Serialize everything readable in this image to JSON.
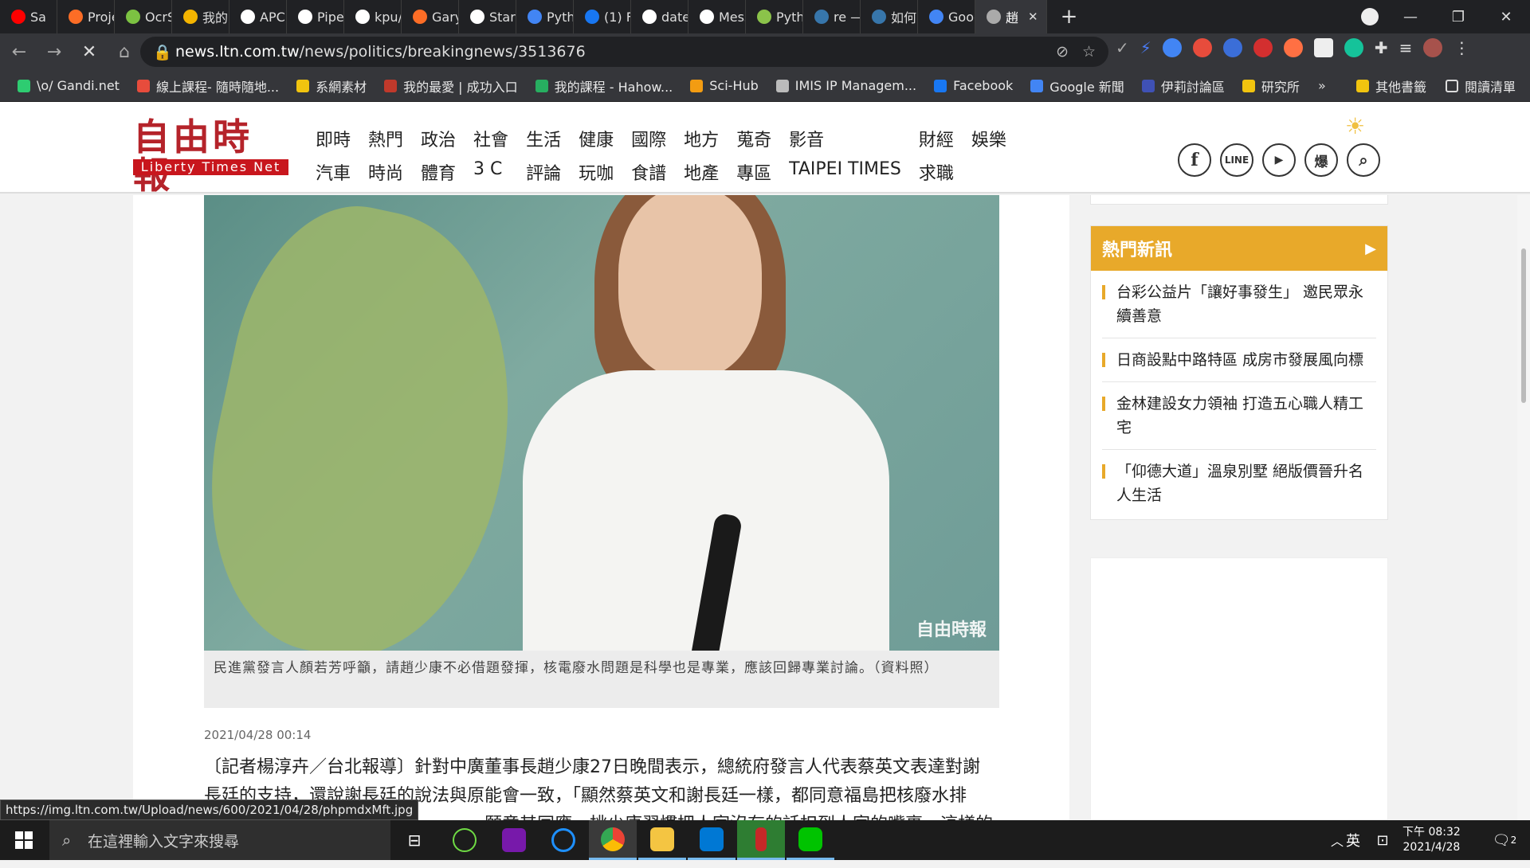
{
  "browser": {
    "tabs": [
      {
        "label": "Sa",
        "icon": "youtube-icon",
        "color": "#ff0000"
      },
      {
        "label": "Proje",
        "icon": "gitlab-icon",
        "color": "#fc6d26"
      },
      {
        "label": "OcrSI",
        "icon": "app-icon",
        "color": "#7cc242"
      },
      {
        "label": "我的",
        "icon": "drive-icon",
        "color": "#f4b400"
      },
      {
        "label": "APCL",
        "icon": "github-icon",
        "color": "#ffffff"
      },
      {
        "label": "Piper",
        "icon": "piper-icon",
        "color": "#ffffff"
      },
      {
        "label": "kpu/",
        "icon": "github-icon",
        "color": "#ffffff"
      },
      {
        "label": "Gary",
        "icon": "gitlab-icon",
        "color": "#fc6d26"
      },
      {
        "label": "Start",
        "icon": "start-icon",
        "color": "#ffffff"
      },
      {
        "label": "Pytho",
        "icon": "doc-icon",
        "color": "#4285f4"
      },
      {
        "label": "(1) Fa",
        "icon": "facebook-icon",
        "color": "#1877f2"
      },
      {
        "label": "datet",
        "icon": "google-icon",
        "color": "#ffffff"
      },
      {
        "label": "Mess",
        "icon": "google-icon",
        "color": "#ffffff"
      },
      {
        "label": "Pytho",
        "icon": "app-icon",
        "color": "#8bc34a"
      },
      {
        "label": "re —",
        "icon": "python-icon",
        "color": "#3776ab"
      },
      {
        "label": "如何",
        "icon": "python-icon",
        "color": "#3776ab"
      },
      {
        "label": "Goog",
        "icon": "translate-icon",
        "color": "#4285f4"
      },
      {
        "label": "趙",
        "icon": "loading-icon",
        "color": "#aaaaaa"
      }
    ],
    "new_tab": "+",
    "url_host": "news.ltn.com.tw",
    "url_path": "/news/politics/breakingnews/3513676",
    "bookmarks": [
      {
        "label": "\\o/ Gandi.net",
        "color": "#2ecc71"
      },
      {
        "label": "線上課程- 隨時隨地...",
        "color": "#e74c3c"
      },
      {
        "label": "系網素材",
        "color": "#f1c40f"
      },
      {
        "label": "我的最愛 | 成功入口",
        "color": "#c0392b"
      },
      {
        "label": "我的課程 - Hahow...",
        "color": "#27ae60"
      },
      {
        "label": "Sci-Hub",
        "color": "#f39c12"
      },
      {
        "label": "IMIS IP Managem...",
        "color": "#bbbbbb"
      },
      {
        "label": "Facebook",
        "color": "#1877f2"
      },
      {
        "label": "Google 新聞",
        "color": "#4285f4"
      },
      {
        "label": "伊莉討論區",
        "color": "#3f51b5"
      },
      {
        "label": "研究所",
        "color": "#f1c40f"
      }
    ],
    "bookmarks_more": "»",
    "other_bookmarks": "其他書籤",
    "reading_list": "閱讀清單"
  },
  "site": {
    "logo_zh": "自由時報",
    "logo_en": "Liberty Times Net",
    "nav": [
      "即時",
      "熱門",
      "政治",
      "社會",
      "生活",
      "健康",
      "國際",
      "地方",
      "蒐奇",
      "影音",
      "財經",
      "娛樂",
      "汽車",
      "時尚",
      "體育",
      "3 C",
      "評論",
      "玩咖",
      "食譜",
      "地產",
      "專區",
      "TAIPEI TIMES",
      "求職"
    ],
    "social": [
      "f",
      "LINE",
      "▶",
      "爆"
    ]
  },
  "article": {
    "photo_watermark": "自由時報",
    "caption": "民進黨發言人顏若芳呼籲，請趙少康不必借題發揮，核電廢水問題是科學也是專業，應該回歸專業討論。（資料照）",
    "date": "2021/04/28 00:14",
    "body_lines": [
      "〔記者楊淳卉／台北報導〕針對中廣董事長趙少康27日晚間表示，總統府發言人代表蔡英文表達對謝",
      "長廷的支持，還說謝長廷的說法與原能會一致，「顯然蔡英文和謝長廷一樣，都同意福島把核廢水排",
      "　　　　　　　　　　　　　　　　願意其同應，桃少康習慣把人家沒有的話扣到人家的嘴裏，這樣的習慣並不"
    ]
  },
  "sidebar": {
    "hot_title": "熱門新訊",
    "hot_items": [
      "台彩公益片「讓好事發生」 邀民眾永續善意",
      "日商設點中路特區 成房市發展風向標",
      "金林建設女力領袖 打造五心職人精工宅",
      "「仰德大道」溫泉別墅 絕版價晉升名人生活"
    ]
  },
  "status_url": "https://img.ltn.com.tw/Upload/news/600/2021/04/28/phpmdxMft.jpg",
  "taskbar": {
    "search_placeholder": "在這裡輸入文字來搜尋",
    "ime": "英",
    "time": "下午 08:32",
    "date": "2021/4/28",
    "notifications": "2"
  }
}
